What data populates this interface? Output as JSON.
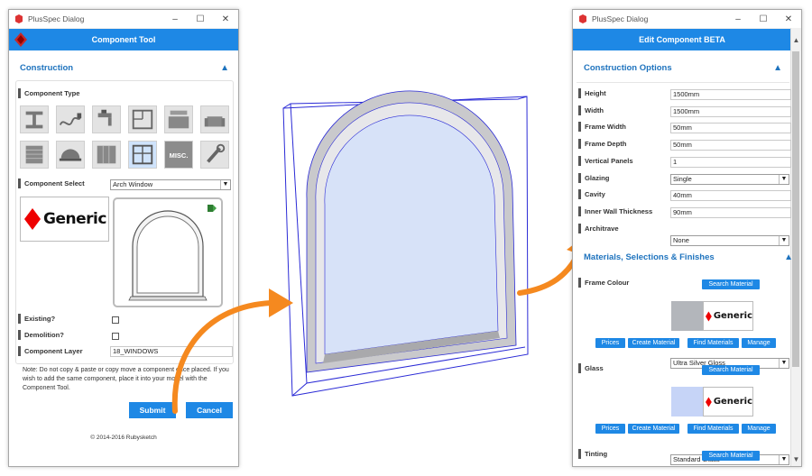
{
  "left_dialog": {
    "window_title": "PlusSpec Dialog",
    "header": "Component Tool",
    "section": "Construction",
    "component_type_label": "Component Type",
    "tiles": [
      {
        "name": "steel-beam-icon",
        "label": ""
      },
      {
        "name": "cable-plug-icon",
        "label": ""
      },
      {
        "name": "tap-icon",
        "label": ""
      },
      {
        "name": "floorplan-icon",
        "label": ""
      },
      {
        "name": "kitchen-icon",
        "label": ""
      },
      {
        "name": "armchair-icon",
        "label": ""
      },
      {
        "name": "shutter-icon",
        "label": ""
      },
      {
        "name": "hardhat-icon",
        "label": ""
      },
      {
        "name": "panel-icon",
        "label": ""
      },
      {
        "name": "window-icon",
        "label": ""
      },
      {
        "name": "misc-icon",
        "label": "MISC."
      },
      {
        "name": "tools-icon",
        "label": ""
      }
    ],
    "component_select_label": "Component Select",
    "component_select_value": "Arch Window",
    "generic_text": "Generic",
    "existing_label": "Existing?",
    "demolition_label": "Demolition?",
    "component_layer_label": "Component Layer",
    "component_layer_value": "18_WINDOWS",
    "note": "Note: Do not copy & paste or copy move a component once placed. If you wish to add the same component, place it into your model with the Component Tool.",
    "submit": "Submit",
    "cancel": "Cancel",
    "copyright": "© 2014-2016 Rubysketch"
  },
  "right_dialog": {
    "window_title": "PlusSpec Dialog",
    "header": "Edit Component BETA",
    "section1": "Construction Options",
    "fields": [
      {
        "label": "Height",
        "value": "1500mm",
        "type": "input"
      },
      {
        "label": "Width",
        "value": "1500mm",
        "type": "input"
      },
      {
        "label": "Frame Width",
        "value": "50mm",
        "type": "input"
      },
      {
        "label": "Frame Depth",
        "value": "50mm",
        "type": "input"
      },
      {
        "label": "Vertical Panels",
        "value": "1",
        "type": "input"
      },
      {
        "label": "Glazing",
        "value": "Single",
        "type": "select"
      },
      {
        "label": "Cavity",
        "value": "40mm",
        "type": "input"
      },
      {
        "label": "Inner Wall Thickness",
        "value": "90mm",
        "type": "input"
      },
      {
        "label": "Architrave",
        "value": "None",
        "type": "select"
      }
    ],
    "section2": "Materials, Selections & Finishes",
    "frame_colour_label": "Frame Colour",
    "frame_colour_value": "Ultra Silver Gloss",
    "frame_swatch": "#b3b6bb",
    "glass_label": "Glass",
    "glass_value": "Standard Glass",
    "glass_swatch": "#c6d4f7",
    "tinting_label": "Tinting",
    "search_material": "Search Material",
    "buttons": [
      "Prices",
      "Create Material",
      "Find Materials",
      "Manage"
    ],
    "generic_text": "Generic"
  },
  "colors": {
    "accent": "#1e88e5",
    "section_text": "#1e73be",
    "arrow": "#f5891f",
    "wireframe": "#2b2bd6"
  }
}
